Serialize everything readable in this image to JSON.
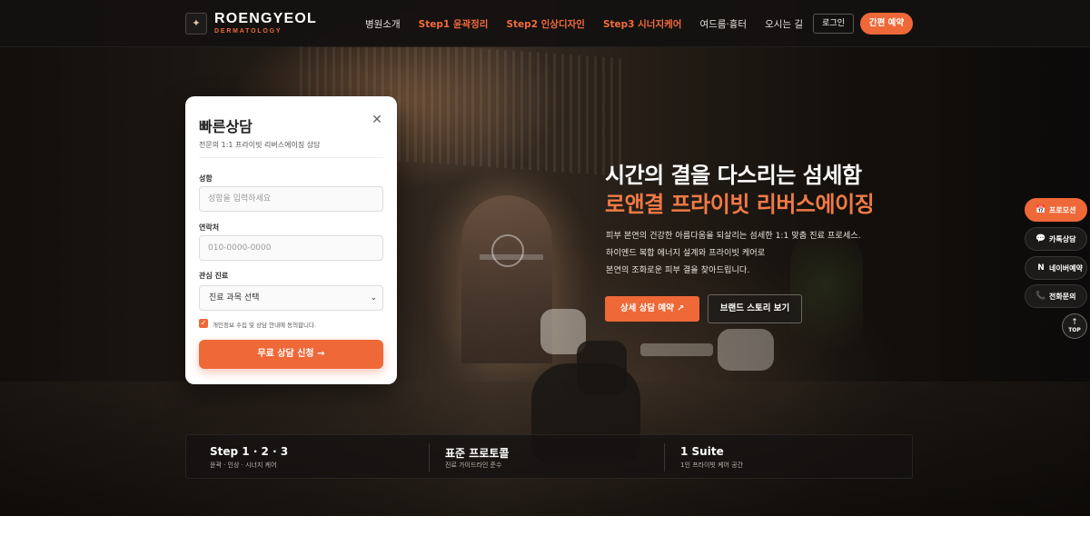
{
  "brand": {
    "mark": "✦",
    "name": "ROENGYEOL",
    "sub": "DERMATOLOGY"
  },
  "nav": {
    "items": [
      {
        "label": "병원소개",
        "accent": false
      },
      {
        "label": "Step1 윤곽정리",
        "accent": true
      },
      {
        "label": "Step2 인상디자인",
        "accent": true
      },
      {
        "label": "Step3 시너지케어",
        "accent": true
      },
      {
        "label": "여드름·흉터",
        "accent": false
      },
      {
        "label": "오시는 길",
        "accent": false
      }
    ],
    "login_label": "로그인",
    "quick_label": "간편 예약"
  },
  "form": {
    "title": "빠른상담",
    "close_icon": "close-icon",
    "description": "전문의 1:1 프라이빗 리버스에이징 상담",
    "name_label": "성함",
    "name_placeholder": "성함을 입력하세요",
    "phone_label": "연락처",
    "phone_placeholder": "010-0000-0000",
    "interest_label": "관심 진료",
    "interest_selected": "진료 과목 선택",
    "agree_text": "개인정보 수집 및 상담 안내에 동의합니다.",
    "agree_checked": true,
    "submit_label": "무료 상담 신청",
    "submit_icon": "→"
  },
  "hero": {
    "title_line1": "시간의 결을 다스리는 섬세함",
    "title_line2": "로앤결 프라이빗 리버스에이징",
    "desc_line1": "피부 본연의 건강한 아름다움을 되살리는 섬세한 1:1 맞춤 진료 프로세스.",
    "desc_line2": "하이엔드 복합 에너지 설계와 프라이빗 케어로",
    "desc_line3": "본연의 조화로운 피부 결을 찾아드립니다.",
    "detail_btn": "상세 상담 예약",
    "detail_icon": "↗",
    "brand_btn": "브랜드 스토리 보기"
  },
  "stats": [
    {
      "title": "Step 1 · 2 · 3",
      "sub": "윤곽 · 인상 · 시너지 케어"
    },
    {
      "title": "표준 프로토콜",
      "sub": "진료 가이드라인 준수"
    },
    {
      "title": "1 Suite",
      "sub": "1인 프라이빗 케어 공간"
    }
  ],
  "floating": {
    "promo": {
      "icon": "📅",
      "label": "프로모션"
    },
    "kakao": {
      "icon": "💬",
      "label": "카톡상담"
    },
    "naver": {
      "icon": "N",
      "label": "네이버예약"
    },
    "phone": {
      "icon": "📞",
      "label": "전화문의"
    },
    "top_arrow": "↑",
    "top_label": "TOP"
  },
  "colors": {
    "accent": "#ee6838",
    "header_bg": "#141211",
    "hero_accent_text": "#f07a46"
  }
}
